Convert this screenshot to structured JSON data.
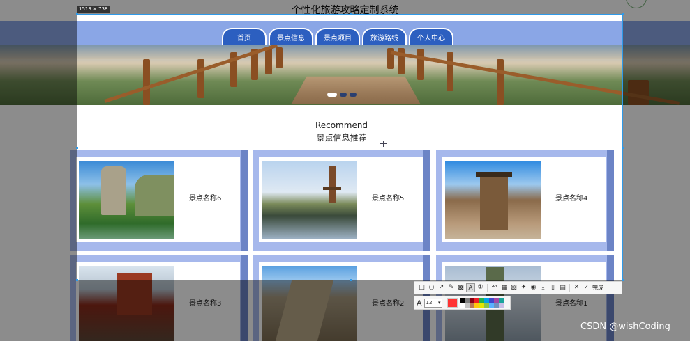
{
  "page": {
    "title": "个性化旅游攻略定制系统"
  },
  "nav": {
    "tabs": [
      {
        "label": "首页"
      },
      {
        "label": "景点信息"
      },
      {
        "label": "景点项目"
      },
      {
        "label": "旅游路线"
      },
      {
        "label": "个人中心"
      }
    ]
  },
  "banner": {
    "slide_count": 3,
    "active_slide": 1
  },
  "recommend": {
    "heading_en": "Recommend",
    "heading_cn": "景点信息推荐",
    "cards": [
      {
        "name": "景点名称6"
      },
      {
        "name": "景点名称5"
      },
      {
        "name": "景点名称4"
      },
      {
        "name": "景点名称3"
      },
      {
        "name": "景点名称2"
      },
      {
        "name": "景点名称1"
      }
    ]
  },
  "capture": {
    "size_label": "1513 × 738",
    "font_size": "12",
    "current_color": "#ff3333",
    "done_label": "完成",
    "tools": [
      "rectangle-icon",
      "ellipse-icon",
      "arrow-icon",
      "pencil-icon",
      "mosaic-icon",
      "text-icon",
      "number-icon",
      "undo-icon",
      "pin-icon",
      "ocr-icon",
      "translate-icon",
      "long-capture-icon",
      "download-icon",
      "copy-icon",
      "save-icon",
      "cancel-icon",
      "confirm-icon"
    ],
    "palette": [
      "#000000",
      "#7f7f7f",
      "#880015",
      "#ed1c24",
      "#22b14c",
      "#00a2e8",
      "#3f48cc",
      "#a349a4",
      "#1aa39b",
      "#ffffff",
      "#c3c3c3",
      "#b97a57",
      "#ffc90e",
      "#e5e500",
      "#8bc34a",
      "#5ab2ff",
      "#7092be",
      "#c8bfe7"
    ]
  },
  "watermark": "CSDN @wishCoding"
}
